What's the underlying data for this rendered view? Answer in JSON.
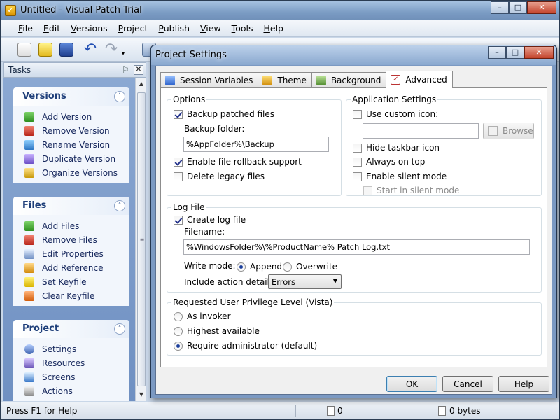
{
  "app": {
    "title": "Untitled - Visual Patch Trial",
    "icon": "app-icon"
  },
  "caption": {
    "minimize": "–",
    "maximize": "□",
    "close": "✕"
  },
  "menu": {
    "items": [
      {
        "label": "File",
        "key": "F",
        "rest": "ile"
      },
      {
        "label": "Edit",
        "key": "E",
        "rest": "dit"
      },
      {
        "label": "Versions",
        "key": "V",
        "rest": "ersions"
      },
      {
        "label": "Project",
        "key": "P",
        "rest": "roject"
      },
      {
        "label": "Publish",
        "key": "P",
        "rest": "ublish"
      },
      {
        "label": "View",
        "key": "V",
        "rest": "iew"
      },
      {
        "label": "Tools",
        "key": "T",
        "rest": "ools"
      },
      {
        "label": "Help",
        "key": "H",
        "rest": "elp"
      }
    ]
  },
  "toolbar": {
    "icons": [
      "new-project-icon",
      "open-project-icon",
      "save-icon",
      "undo-icon",
      "redo-icon"
    ],
    "undo_glyph": "↶",
    "redo_glyph": "↷",
    "dropdown_glyph": "▾"
  },
  "tasks": {
    "title": "Tasks",
    "pin_glyph": "⚐",
    "close_glyph": "✕",
    "collapse_glyph": "˄",
    "groups": [
      {
        "title": "Versions",
        "items": [
          {
            "label": "Add Version",
            "icon": "add-version-icon"
          },
          {
            "label": "Remove Version",
            "icon": "remove-version-icon"
          },
          {
            "label": "Rename Version",
            "icon": "rename-version-icon"
          },
          {
            "label": "Duplicate Version",
            "icon": "duplicate-version-icon"
          },
          {
            "label": "Organize Versions",
            "icon": "organize-versions-icon"
          }
        ]
      },
      {
        "title": "Files",
        "items": [
          {
            "label": "Add Files",
            "icon": "add-files-icon"
          },
          {
            "label": "Remove Files",
            "icon": "remove-files-icon"
          },
          {
            "label": "Edit Properties",
            "icon": "edit-properties-icon"
          },
          {
            "label": "Add Reference",
            "icon": "add-reference-icon"
          },
          {
            "label": "Set Keyfile",
            "icon": "set-keyfile-icon"
          },
          {
            "label": "Clear Keyfile",
            "icon": "clear-keyfile-icon"
          }
        ]
      },
      {
        "title": "Project",
        "items": [
          {
            "label": "Settings",
            "icon": "settings-icon"
          },
          {
            "label": "Resources",
            "icon": "resources-icon"
          },
          {
            "label": "Screens",
            "icon": "screens-icon"
          },
          {
            "label": "Actions",
            "icon": "actions-icon"
          }
        ]
      }
    ]
  },
  "status": {
    "help_text": "Press F1 for Help",
    "count": "0",
    "size": "0 bytes"
  },
  "dialog": {
    "title": "Project Settings",
    "tabs": [
      {
        "label": "Session Variables",
        "icon": "session-variables-icon",
        "active": false
      },
      {
        "label": "Theme",
        "icon": "theme-icon",
        "active": false
      },
      {
        "label": "Background",
        "icon": "background-icon",
        "active": false
      },
      {
        "label": "Advanced",
        "icon": "advanced-icon",
        "active": true
      }
    ],
    "options": {
      "legend": "Options",
      "backup_patched_files": {
        "label": "Backup patched files",
        "checked": true
      },
      "backup_folder_label": "Backup folder:",
      "backup_folder_value": "%AppFolder%\\Backup",
      "enable_rollback": {
        "label": "Enable file rollback support",
        "checked": true
      },
      "delete_legacy": {
        "label": "Delete legacy files",
        "checked": false
      }
    },
    "app_settings": {
      "legend": "Application Settings",
      "use_custom_icon": {
        "label": "Use custom icon:",
        "checked": false
      },
      "custom_icon_path": "",
      "browse_label": "Browse",
      "hide_taskbar_icon": {
        "label": "Hide taskbar icon",
        "checked": false
      },
      "always_on_top": {
        "label": "Always on top",
        "checked": false
      },
      "enable_silent_mode": {
        "label": "Enable silent mode",
        "checked": false
      },
      "start_in_silent_mode": {
        "label": "Start in silent mode",
        "checked": false,
        "disabled": true
      }
    },
    "log_file": {
      "legend": "Log File",
      "create_log_file": {
        "label": "Create log file",
        "checked": true
      },
      "filename_label": "Filename:",
      "filename_value": "%WindowsFolder%\\%ProductName% Patch Log.txt",
      "write_mode_label": "Write mode:",
      "write_mode_options": [
        {
          "label": "Append",
          "checked": true
        },
        {
          "label": "Overwrite",
          "checked": false
        }
      ],
      "include_details_label": "Include action details:",
      "include_details_value": "Errors"
    },
    "privilege": {
      "legend": "Requested User Privilege Level (Vista)",
      "options": [
        {
          "label": "As invoker",
          "checked": false
        },
        {
          "label": "Highest available",
          "checked": false
        },
        {
          "label": "Require administrator (default)",
          "checked": true
        }
      ]
    },
    "buttons": {
      "ok": "OK",
      "cancel": "Cancel",
      "help": "Help"
    }
  }
}
